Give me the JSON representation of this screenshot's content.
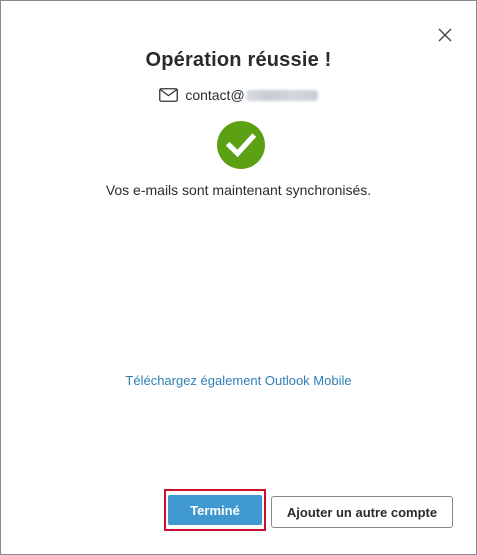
{
  "dialog": {
    "title": "Opération réussie !",
    "account": {
      "icon": "mail-icon",
      "email_prefix": "contact@"
    },
    "status_icon": "check-circle-icon",
    "status_color": "#5ca114",
    "message": "Vos e-mails sont maintenant synchronisés.",
    "mobile_link": "Téléchargez également Outlook Mobile",
    "close_icon": "close-icon",
    "buttons": {
      "done_label": "Terminé",
      "add_account_label": "Ajouter un autre compte"
    },
    "colors": {
      "primary_button": "#3f98cf",
      "link": "#2f7fb5",
      "highlight": "#c8102e"
    }
  }
}
